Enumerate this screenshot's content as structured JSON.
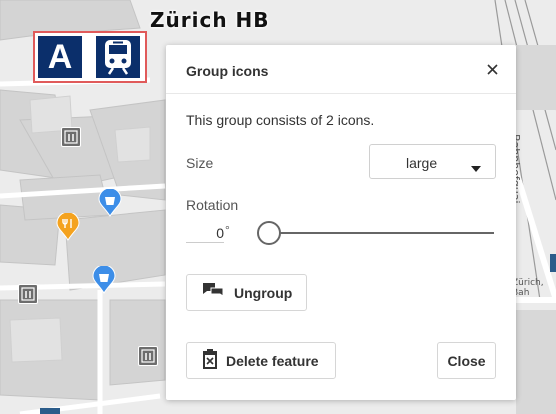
{
  "map": {
    "station_title": "Zürich HB",
    "street_vertical": "Bahnhofquai",
    "street_horizontal": "Zürich, Bah",
    "group_icon_letter": "A",
    "colors": {
      "group_border": "#e05a5a",
      "sign_blue": "#0b2f6b",
      "food_poi": "#f4a21e",
      "shop_poi": "#3d8ee8",
      "elevator_poi": "#6d6d6d"
    }
  },
  "dialog": {
    "title": "Group icons",
    "description": "This group consists of 2 icons.",
    "size": {
      "label": "Size",
      "value": "large"
    },
    "rotation": {
      "label": "Rotation",
      "value": "0",
      "unit": "°",
      "slider_fraction": 0
    },
    "ungroup_label": "Ungroup",
    "delete_label": "Delete feature",
    "close_label": "Close"
  }
}
